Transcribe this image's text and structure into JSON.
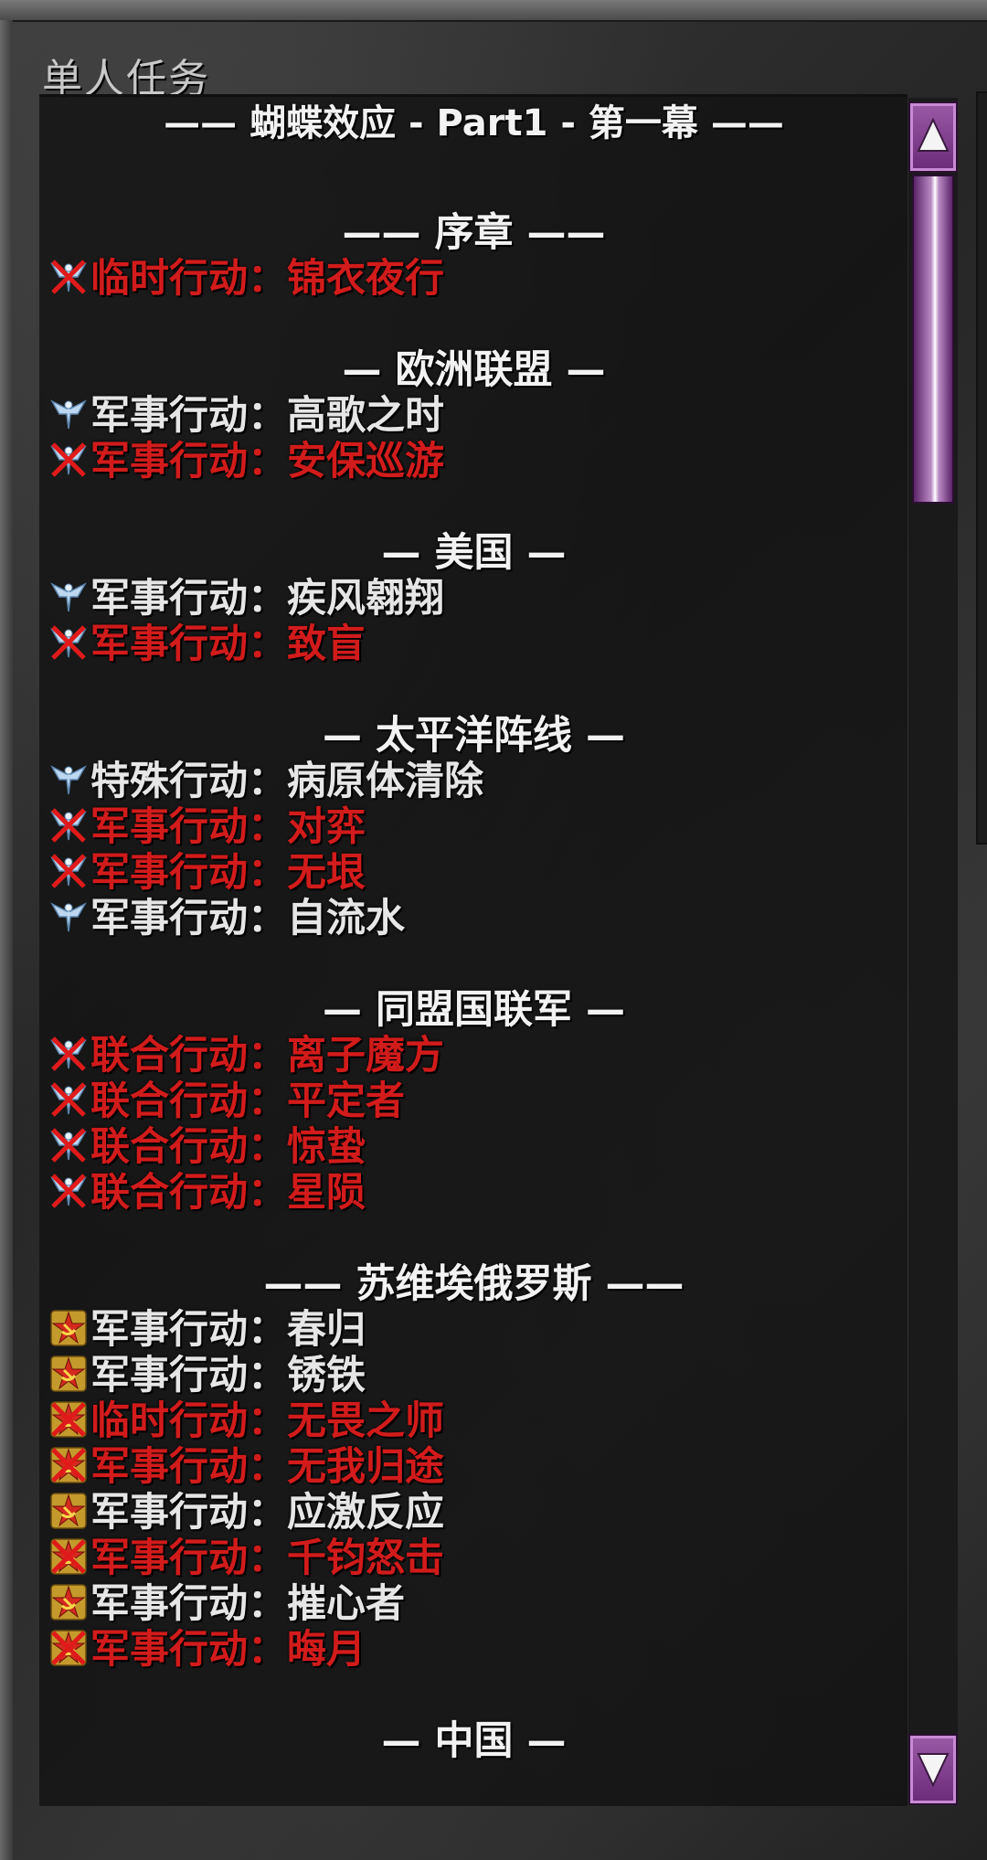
{
  "window": {
    "title": "单人任务"
  },
  "colors": {
    "completed": "#e6e6e6",
    "locked": "#d21b1b",
    "scrollbar_purple": "#8a4a96"
  },
  "campaign": {
    "title": "—— 蝴蝶效应 - Part1 - 第一幕 ——",
    "sections": [
      {
        "header": "—— 序章 ——",
        "missions": [
          {
            "type": "临时行动",
            "name": "锦衣夜行",
            "status": "locked",
            "icon": "allied-eagle-crossed-icon"
          }
        ]
      },
      {
        "header": "— 欧洲联盟 —",
        "missions": [
          {
            "type": "军事行动",
            "name": "高歌之时",
            "status": "completed",
            "icon": "allied-eagle-icon"
          },
          {
            "type": "军事行动",
            "name": "安保巡游",
            "status": "locked",
            "icon": "allied-eagle-crossed-icon"
          }
        ]
      },
      {
        "header": "— 美国 —",
        "missions": [
          {
            "type": "军事行动",
            "name": "疾风翱翔",
            "status": "completed",
            "icon": "allied-eagle-icon"
          },
          {
            "type": "军事行动",
            "name": "致盲",
            "status": "locked",
            "icon": "allied-eagle-crossed-icon"
          }
        ]
      },
      {
        "header": "— 太平洋阵线 —",
        "missions": [
          {
            "type": "特殊行动",
            "name": "病原体清除",
            "status": "completed",
            "icon": "allied-eagle-icon"
          },
          {
            "type": "军事行动",
            "name": "对弈",
            "status": "locked",
            "icon": "allied-eagle-crossed-icon"
          },
          {
            "type": "军事行动",
            "name": "无垠",
            "status": "locked",
            "icon": "allied-eagle-crossed-icon"
          },
          {
            "type": "军事行动",
            "name": "自流水",
            "status": "completed",
            "icon": "allied-eagle-icon"
          }
        ]
      },
      {
        "header": "— 同盟国联军 —",
        "missions": [
          {
            "type": "联合行动",
            "name": "离子魔方",
            "status": "locked",
            "icon": "allied-eagle-crossed-icon"
          },
          {
            "type": "联合行动",
            "name": "平定者",
            "status": "locked",
            "icon": "allied-eagle-crossed-icon"
          },
          {
            "type": "联合行动",
            "name": "惊蛰",
            "status": "locked",
            "icon": "allied-eagle-crossed-icon"
          },
          {
            "type": "联合行动",
            "name": "星陨",
            "status": "locked",
            "icon": "allied-eagle-crossed-icon"
          }
        ]
      },
      {
        "header": "—— 苏维埃俄罗斯 ——",
        "missions": [
          {
            "type": "军事行动",
            "name": "春归",
            "status": "completed",
            "icon": "soviet-star-icon"
          },
          {
            "type": "军事行动",
            "name": "锈铁",
            "status": "completed",
            "icon": "soviet-star-icon"
          },
          {
            "type": "临时行动",
            "name": "无畏之师",
            "status": "locked",
            "icon": "soviet-star-crossed-icon"
          },
          {
            "type": "军事行动",
            "name": "无我归途",
            "status": "locked",
            "icon": "soviet-star-crossed-icon"
          },
          {
            "type": "军事行动",
            "name": "应激反应",
            "status": "completed",
            "icon": "soviet-star-icon"
          },
          {
            "type": "军事行动",
            "name": "千钧怒击",
            "status": "locked",
            "icon": "soviet-star-crossed-icon"
          },
          {
            "type": "军事行动",
            "name": "摧心者",
            "status": "completed",
            "icon": "soviet-star-icon"
          },
          {
            "type": "军事行动",
            "name": "晦月",
            "status": "locked",
            "icon": "soviet-star-crossed-icon"
          }
        ]
      },
      {
        "header": "— 中国 —",
        "missions": []
      }
    ]
  },
  "scrollbar": {
    "up_icon": "scroll-up-arrow-icon",
    "down_icon": "scroll-down-arrow-icon",
    "position_fraction": 0.0
  }
}
